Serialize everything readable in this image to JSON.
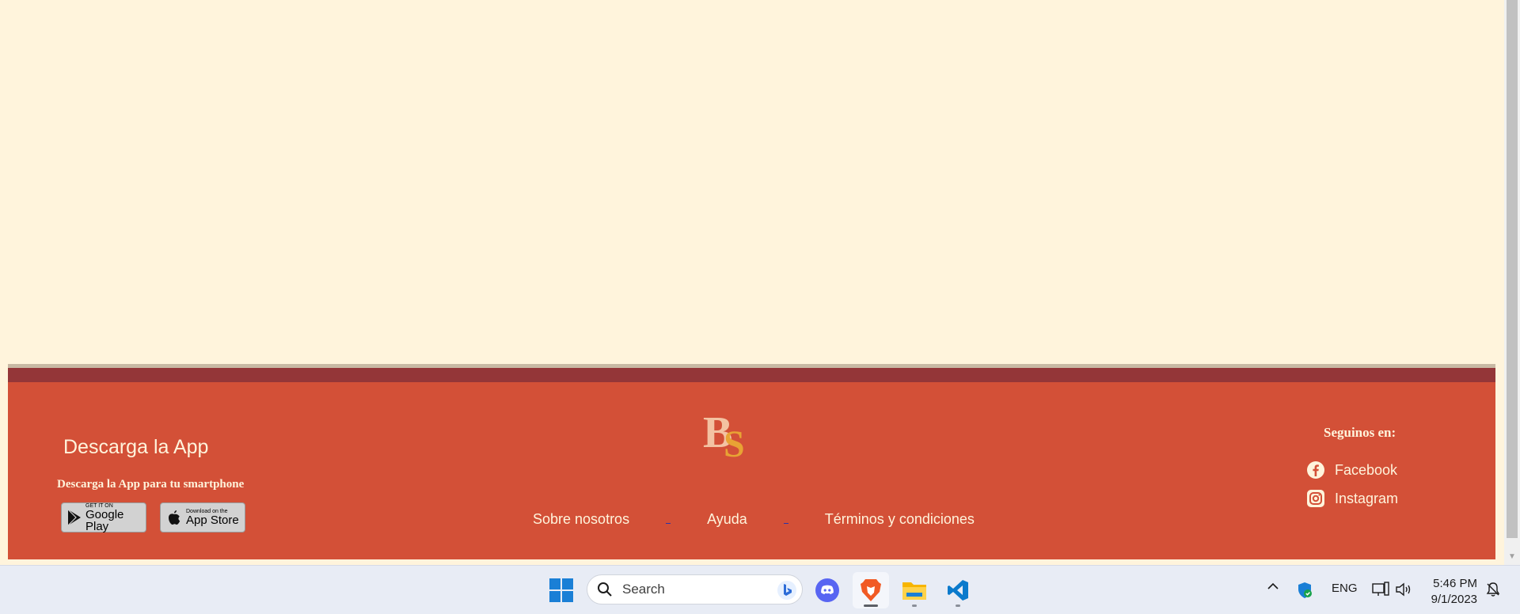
{
  "footer": {
    "app_heading": "Descarga la App",
    "app_subheading": "Descarga la App para tu smartphone",
    "google_play": {
      "small": "GET IT ON",
      "big": "Google Play"
    },
    "app_store": {
      "small": "Download on the",
      "big": "App Store"
    },
    "logo_letters": "BS",
    "links": [
      "Sobre nosotros",
      "Ayuda",
      "Términos y condiciones"
    ],
    "follow_heading": "Seguinos en:",
    "social": [
      {
        "label": "Facebook",
        "icon": "facebook-icon"
      },
      {
        "label": "Instagram",
        "icon": "instagram-icon"
      }
    ]
  },
  "taskbar": {
    "search_placeholder": "Search",
    "apps": [
      "start-icon",
      "discord-icon",
      "brave-icon",
      "file-explorer-icon",
      "vscode-icon"
    ],
    "tray": {
      "language": "ENG",
      "time": "5:46 PM",
      "date": "9/1/2023"
    }
  },
  "colors": {
    "page_bg": "#fff4dc",
    "footer_bg": "#d35037",
    "footer_band": "#943638",
    "footer_text": "#fff4dc",
    "taskbar_bg": "#e8ecf5"
  }
}
